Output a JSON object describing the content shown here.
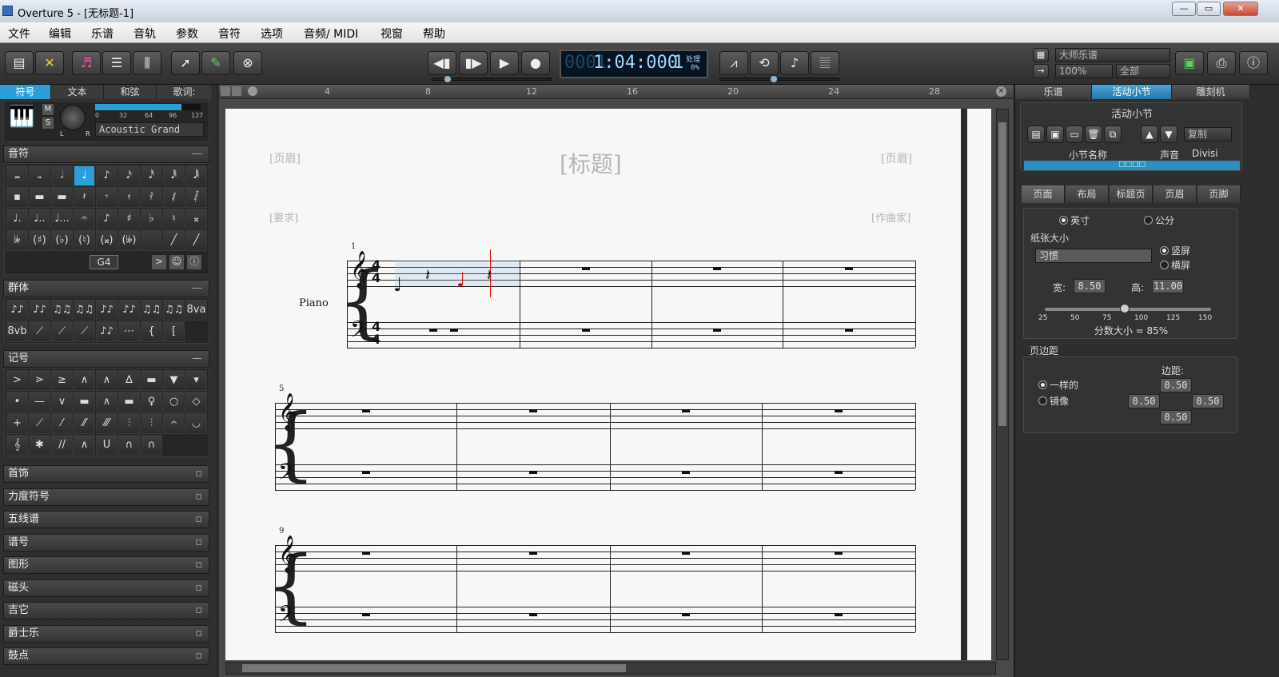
{
  "window": {
    "title": "Overture 5 - [无标题-1]",
    "minimize": "—",
    "restore": "▭",
    "close": "✕"
  },
  "menu": [
    "文件",
    "编辑",
    "乐谱",
    "音轨",
    "参数",
    "音符",
    "选项",
    "音频/ MIDI",
    "视窗",
    "帮助"
  ],
  "transport": {
    "bar": "0001",
    "time": "1:04:000",
    "beat": "1",
    "proc_label": "处理",
    "proc_val": "0%"
  },
  "toolbar_right": {
    "library": "大师乐谱",
    "zoom": "100%",
    "scope": "全部"
  },
  "left_tabs": [
    "符号",
    "文本",
    "和弦",
    "歌词:"
  ],
  "instrument": {
    "name": "Piano",
    "patch": "Acoustic Grand",
    "m": "M",
    "s": "S",
    "l": "L",
    "r": "R",
    "vel_ticks": [
      "0",
      "32",
      "64",
      "96",
      "127"
    ],
    "vel_value": 104,
    "vel_max": 127
  },
  "panels": {
    "notes": "音符",
    "groups": "群体",
    "marks": "记号",
    "min": "—",
    "pitch_field": "G4"
  },
  "note_cells": [
    "𝅜",
    "𝅝",
    "𝅗𝅥",
    "♩",
    "♪",
    "𝅘𝅥𝅯",
    "𝅘𝅥𝅰",
    "𝅘𝅥𝅱",
    "𝅘𝅥𝅲",
    "▪",
    "▬",
    "▬",
    "𝄽",
    "𝄾",
    "𝄿",
    "𝅀",
    "𝅁",
    "𝅂",
    "♩.",
    "♩..",
    "♩...",
    "𝄐",
    "♪",
    "♯",
    "♭",
    "♮",
    "𝄪",
    "𝄫",
    "(♯)",
    "(♭)",
    "(♮)",
    "(𝄪)",
    "(𝄫)",
    "",
    "╱",
    "╱"
  ],
  "group_cells": [
    "♪♪",
    "♪♪",
    "♫♫",
    "♫♫",
    "♪♪",
    "♪♪",
    "♫♫",
    "♫♫",
    "8va",
    "8vb",
    "⟋",
    "⟋",
    "⟋",
    "♪♪",
    "⋯",
    "{",
    "["
  ],
  "mark_cells": [
    ">",
    "⋗",
    "≥",
    "∧",
    "∧",
    "∆",
    "▬",
    "▼",
    "▾",
    "•",
    "—",
    "∨",
    "▬",
    "∧",
    "▬",
    "♀",
    "○",
    "◇",
    "+",
    "⟋",
    "⁄",
    "⁄⁄",
    "⁄⁄⁄",
    "⫶",
    "⫶",
    "𝄐",
    "◡",
    "𝄞",
    "✱",
    "//",
    "∧",
    "U",
    "∩",
    "∩"
  ],
  "collapsed_panels": [
    "首饰",
    "力度符号",
    "五线谱",
    "谱号",
    "图形",
    "磁头",
    "吉它",
    "爵士乐",
    "鼓点"
  ],
  "ruler": [
    "4",
    "8",
    "12",
    "16",
    "20",
    "24",
    "28"
  ],
  "score": {
    "title": "[标题]",
    "header_left": "[页眉]",
    "header_right": "[页眉]",
    "instructions": "[要求]",
    "composer": "[作曲家]",
    "instrument_label": "Piano",
    "time_sig": "4/4",
    "system_numbers": [
      "1",
      "5",
      "9"
    ]
  },
  "right_tabs": [
    "乐谱",
    "活动小节",
    "雕刻机"
  ],
  "active_measure": {
    "title": "活动小节",
    "copy": "复制",
    "col_name": "小节名称",
    "col_voice": "声音",
    "col_divisi": "Divisi",
    "row": "□□□□"
  },
  "page_tabs": [
    "页面",
    "布局",
    "标题页",
    "页眉",
    "页脚"
  ],
  "page": {
    "unit_in": "英寸",
    "unit_cm": "公分",
    "paper_label": "纸张大小",
    "paper_value": "习惯",
    "portrait": "竖屏",
    "landscape": "横屏",
    "width_label": "宽:",
    "width": "8.50",
    "height_label": "高:",
    "height": "11.00",
    "scale_ticks": [
      "25",
      "50",
      "75",
      "100",
      "125",
      "150"
    ],
    "scale_text": "分数大小 = 85%",
    "scale_value": 85,
    "margins_label": "页边距",
    "same": "一样的",
    "mirror": "镜像",
    "margin_label": "边距:",
    "m_top": "0.50",
    "m_left": "0.50",
    "m_right": "0.50",
    "m_bottom": "0.50"
  },
  "colors": {
    "accent": "#2c9fd8",
    "lcd": "#9fd6ff"
  }
}
